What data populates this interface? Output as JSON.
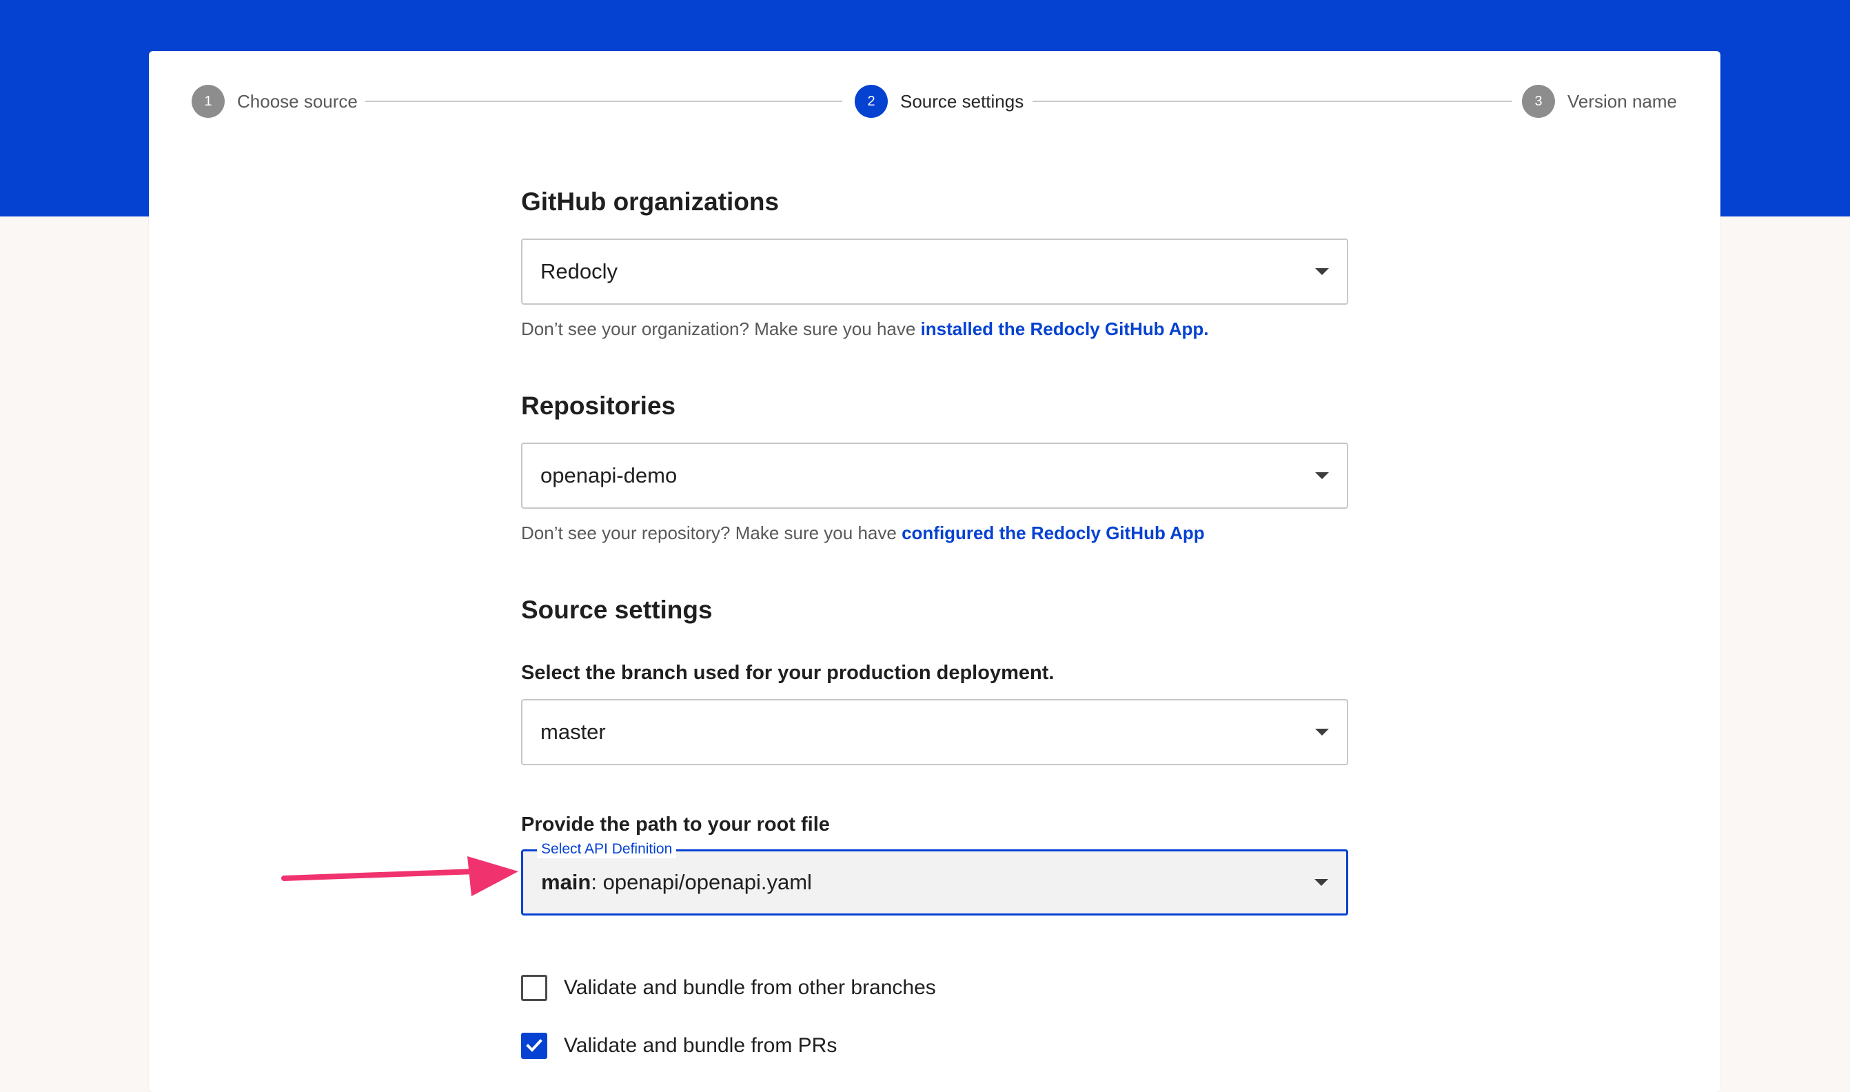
{
  "stepper": {
    "steps": [
      {
        "number": "1",
        "label": "Choose source"
      },
      {
        "number": "2",
        "label": "Source settings"
      },
      {
        "number": "3",
        "label": "Version name"
      }
    ]
  },
  "github_orgs": {
    "title": "GitHub organizations",
    "selected": "Redocly",
    "help_text": "Don’t see your organization? Make sure you have ",
    "help_link": "installed the Redocly GitHub App."
  },
  "repositories": {
    "title": "Repositories",
    "selected": "openapi-demo",
    "help_text": "Don’t see your repository? Make sure you have ",
    "help_link": "configured the Redocly GitHub App"
  },
  "source_settings": {
    "title": "Source settings",
    "branch_label": "Select the branch used for your production deployment.",
    "branch_selected": "master",
    "root_file_label": "Provide the path to your root file",
    "root_file_float_label": "Select API Definition",
    "root_file_branch": "main",
    "root_file_path": ": openapi/openapi.yaml"
  },
  "checkboxes": [
    {
      "label": "Validate and bundle from other branches",
      "checked": false
    },
    {
      "label": "Validate and bundle from PRs",
      "checked": true
    }
  ],
  "colors": {
    "brand": "#0542d1",
    "annotation_arrow": "#f0336e"
  }
}
